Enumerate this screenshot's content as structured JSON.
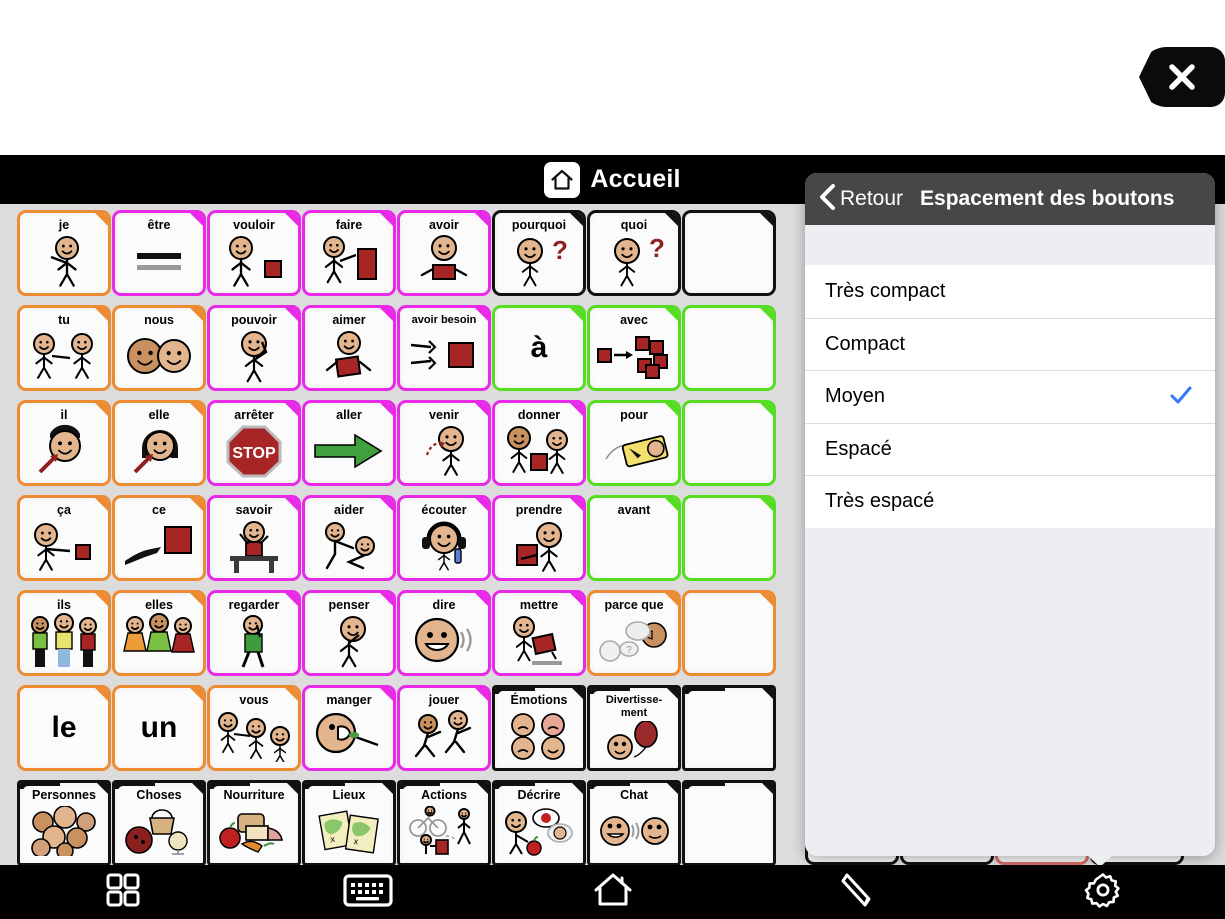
{
  "window": {
    "close_icon": "close-x-icon"
  },
  "header": {
    "home_icon": "home-icon",
    "title": "Accueil"
  },
  "toolbar": {
    "items": [
      {
        "icon": "grid-icon",
        "name": "grid-button"
      },
      {
        "icon": "keyboard-icon",
        "name": "keyboard-button"
      },
      {
        "icon": "home-icon",
        "name": "home-button"
      },
      {
        "icon": "pencil-icon",
        "name": "edit-button"
      },
      {
        "icon": "gear-icon",
        "name": "settings-button"
      }
    ]
  },
  "popover": {
    "back_icon": "chevron-left-icon",
    "back_label": "Retour",
    "title": "Espacement des boutons",
    "selected": "Moyen",
    "check_icon": "checkmark-icon",
    "check_color": "#3478f6",
    "options": [
      {
        "label": "Très compact",
        "checked": false
      },
      {
        "label": "Compact",
        "checked": false
      },
      {
        "label": "Moyen",
        "checked": true
      },
      {
        "label": "Espacé",
        "checked": false
      },
      {
        "label": "Très espacé",
        "checked": false
      }
    ]
  },
  "colors": {
    "pronoun_orange": "#ED8B33",
    "verb_magenta": "#E829E8",
    "question_black": "#111111",
    "preposition_green": "#55DD22",
    "folder_black": "#111111",
    "board_bg": "#dcdcdc"
  },
  "board": {
    "rows": 8,
    "cols": 8,
    "cells": [
      {
        "r": 0,
        "c": 0,
        "label": "je",
        "color": "#ED8B33",
        "art": "person-pointing-self"
      },
      {
        "r": 0,
        "c": 1,
        "label": "être",
        "color": "#E829E8",
        "art": "equals-bars"
      },
      {
        "r": 0,
        "c": 2,
        "label": "vouloir",
        "color": "#E829E8",
        "art": "person-reaching-block"
      },
      {
        "r": 0,
        "c": 3,
        "label": "faire",
        "color": "#E829E8",
        "art": "person-hammer-block"
      },
      {
        "r": 0,
        "c": 4,
        "label": "avoir",
        "color": "#E829E8",
        "art": "person-holding-block"
      },
      {
        "r": 0,
        "c": 5,
        "label": "pourquoi",
        "color": "#111111",
        "art": "person-thinking-question"
      },
      {
        "r": 0,
        "c": 6,
        "label": "quoi",
        "color": "#111111",
        "art": "person-shrug-question"
      },
      {
        "r": 0,
        "c": 7,
        "label": "",
        "color": "#111111",
        "art": "blank"
      },
      {
        "r": 1,
        "c": 0,
        "label": "tu",
        "color": "#ED8B33",
        "art": "two-people-pointing"
      },
      {
        "r": 1,
        "c": 1,
        "label": "nous",
        "color": "#ED8B33",
        "art": "two-heads"
      },
      {
        "r": 1,
        "c": 2,
        "label": "pouvoir",
        "color": "#E829E8",
        "art": "person-flexing"
      },
      {
        "r": 1,
        "c": 3,
        "label": "aimer",
        "color": "#E829E8",
        "art": "person-hugging-heart"
      },
      {
        "r": 1,
        "c": 4,
        "label": "avoir besoin",
        "color": "#E829E8",
        "art": "hands-reaching-block"
      },
      {
        "r": 1,
        "c": 5,
        "label": "à",
        "color": "#55DD22",
        "art": "bigword"
      },
      {
        "r": 1,
        "c": 6,
        "label": "avec",
        "color": "#55DD22",
        "art": "blocks-arrow-cluster"
      },
      {
        "r": 1,
        "c": 7,
        "label": "",
        "color": "#55DD22",
        "art": "blank"
      },
      {
        "r": 2,
        "c": 0,
        "label": "il",
        "color": "#ED8B33",
        "art": "head-arrow-male"
      },
      {
        "r": 2,
        "c": 1,
        "label": "elle",
        "color": "#ED8B33",
        "art": "head-arrow-female"
      },
      {
        "r": 2,
        "c": 2,
        "label": "arrêter",
        "color": "#E829E8",
        "art": "stop-sign"
      },
      {
        "r": 2,
        "c": 3,
        "label": "aller",
        "color": "#E829E8",
        "art": "green-arrow"
      },
      {
        "r": 2,
        "c": 4,
        "label": "venir",
        "color": "#E829E8",
        "art": "person-beckoning"
      },
      {
        "r": 2,
        "c": 5,
        "label": "donner",
        "color": "#E829E8",
        "art": "two-people-giving-block"
      },
      {
        "r": 2,
        "c": 6,
        "label": "pour",
        "color": "#55DD22",
        "art": "yellow-tag"
      },
      {
        "r": 2,
        "c": 7,
        "label": "",
        "color": "#55DD22",
        "art": "blank"
      },
      {
        "r": 3,
        "c": 0,
        "label": "ça",
        "color": "#ED8B33",
        "art": "person-pointing-block"
      },
      {
        "r": 3,
        "c": 1,
        "label": "ce",
        "color": "#ED8B33",
        "art": "hand-pointing-block"
      },
      {
        "r": 3,
        "c": 2,
        "label": "savoir",
        "color": "#E829E8",
        "art": "person-raising-hand-desk"
      },
      {
        "r": 3,
        "c": 3,
        "label": "aider",
        "color": "#E829E8",
        "art": "person-helping-up"
      },
      {
        "r": 3,
        "c": 4,
        "label": "écouter",
        "color": "#E829E8",
        "art": "person-headphones"
      },
      {
        "r": 3,
        "c": 5,
        "label": "prendre",
        "color": "#E829E8",
        "art": "person-taking-block"
      },
      {
        "r": 3,
        "c": 6,
        "label": "avant",
        "color": "#55DD22",
        "art": "two-blocks-arrow-back"
      },
      {
        "r": 3,
        "c": 7,
        "label": "",
        "color": "#55DD22",
        "art": "blank"
      },
      {
        "r": 4,
        "c": 0,
        "label": "ils",
        "color": "#ED8B33",
        "art": "three-people-male"
      },
      {
        "r": 4,
        "c": 1,
        "label": "elles",
        "color": "#ED8B33",
        "art": "three-people-female"
      },
      {
        "r": 4,
        "c": 2,
        "label": "regarder",
        "color": "#E829E8",
        "art": "person-walking-looking"
      },
      {
        "r": 4,
        "c": 3,
        "label": "penser",
        "color": "#E829E8",
        "art": "person-thinking"
      },
      {
        "r": 4,
        "c": 4,
        "label": "dire",
        "color": "#E829E8",
        "art": "face-speaking"
      },
      {
        "r": 4,
        "c": 5,
        "label": "mettre",
        "color": "#E829E8",
        "art": "person-putting-block"
      },
      {
        "r": 4,
        "c": 6,
        "label": "parce que",
        "color": "#ED8B33",
        "art": "speech-bubbles-question"
      },
      {
        "r": 4,
        "c": 7,
        "label": "",
        "color": "#ED8B33",
        "art": "blank"
      },
      {
        "r": 5,
        "c": 0,
        "label": "le",
        "color": "#ED8B33",
        "art": "bigword"
      },
      {
        "r": 5,
        "c": 1,
        "label": "un",
        "color": "#ED8B33",
        "art": "bigword"
      },
      {
        "r": 5,
        "c": 2,
        "label": "vous",
        "color": "#ED8B33",
        "art": "person-pointing-group"
      },
      {
        "r": 5,
        "c": 3,
        "label": "manger",
        "color": "#E829E8",
        "art": "face-eating-fork"
      },
      {
        "r": 5,
        "c": 4,
        "label": "jouer",
        "color": "#E829E8",
        "art": "two-people-running"
      },
      {
        "r": 5,
        "c": 5,
        "label": "Émotions",
        "color": "#111111",
        "art": "four-faces",
        "folder": true
      },
      {
        "r": 5,
        "c": 6,
        "label": "Divertisse-ment",
        "color": "#111111",
        "art": "face-balloon",
        "folder": true
      },
      {
        "r": 5,
        "c": 7,
        "label": "",
        "color": "#111111",
        "art": "blank",
        "folder": true
      },
      {
        "r": 6,
        "c": 0,
        "label": "Personnes",
        "color": "#111111",
        "art": "group-faces",
        "folder": true
      },
      {
        "r": 6,
        "c": 1,
        "label": "Choses",
        "color": "#111111",
        "art": "basket-ball-toy",
        "folder": true
      },
      {
        "r": 6,
        "c": 2,
        "label": "Nourriture",
        "color": "#111111",
        "art": "food-items",
        "folder": true
      },
      {
        "r": 6,
        "c": 3,
        "label": "Lieux",
        "color": "#111111",
        "art": "two-maps",
        "folder": true
      },
      {
        "r": 6,
        "c": 4,
        "label": "Actions",
        "color": "#111111",
        "art": "bike-walk-people",
        "folder": true
      },
      {
        "r": 6,
        "c": 5,
        "label": "Décrire",
        "color": "#111111",
        "art": "person-describing-apple",
        "folder": true
      },
      {
        "r": 6,
        "c": 6,
        "label": "Chat",
        "color": "#111111",
        "art": "two-faces-talking",
        "folder": true
      },
      {
        "r": 6,
        "c": 7,
        "label": "",
        "color": "#111111",
        "art": "blank",
        "folder": true
      }
    ]
  }
}
